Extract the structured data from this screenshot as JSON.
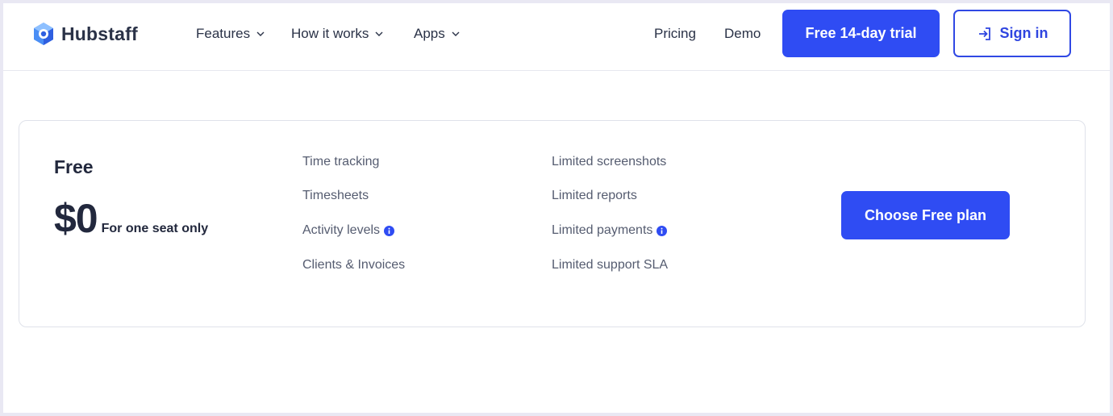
{
  "brand": {
    "name": "Hubstaff",
    "logo_icon": "hubstaff-logo-icon",
    "accent_color": "#2f4cf3"
  },
  "nav": {
    "items": [
      {
        "label": "Features",
        "icon": "chevron-down-icon"
      },
      {
        "label": "How it works",
        "icon": "chevron-down-icon"
      },
      {
        "label": "Apps",
        "icon": "chevron-down-icon"
      }
    ],
    "pricing": "Pricing",
    "demo": "Demo",
    "trial_button": "Free 14-day trial",
    "signin_button": "Sign in",
    "signin_icon": "sign-in-arrow-icon"
  },
  "plan": {
    "name": "Free",
    "price": "$0",
    "price_note": "For one seat only",
    "features_col1": [
      {
        "label": "Time tracking",
        "info": false
      },
      {
        "label": "Timesheets",
        "info": false
      },
      {
        "label": "Activity levels",
        "info": true
      },
      {
        "label": "Clients & Invoices",
        "info": false
      }
    ],
    "features_col2": [
      {
        "label": "Limited screenshots",
        "info": false
      },
      {
        "label": "Limited reports",
        "info": false
      },
      {
        "label": "Limited payments",
        "info": true
      },
      {
        "label": "Limited support SLA",
        "info": false
      }
    ],
    "cta": "Choose Free plan"
  }
}
